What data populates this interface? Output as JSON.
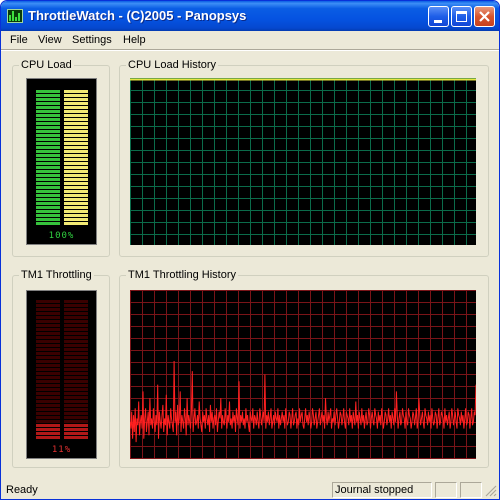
{
  "window": {
    "title": "ThrottleWatch - (C)2005 - Panopsys"
  },
  "menu": {
    "items": [
      "File",
      "View",
      "Settings",
      "Help"
    ]
  },
  "cpu_load": {
    "label": "CPU Load",
    "percent_text": "100%",
    "level": 1.0,
    "bar_colors": {
      "left": "#36c23c",
      "right": "#f2ea74"
    },
    "percent_color": "#30d040"
  },
  "cpu_history": {
    "label": "CPU Load History",
    "grid_color": "#0b6b4a",
    "line_color": "#e6e640"
  },
  "tm1_throttling": {
    "label": "TM1 Throttling",
    "percent_text": "11%",
    "level": 0.11,
    "bar_color": "#b01818",
    "dim_color": "#3a0000",
    "percent_color": "#e03030"
  },
  "tm1_history": {
    "label": "TM1 Throttling History",
    "grid_color": "#7a1418",
    "line_color": "#ff2020",
    "values": [
      22,
      18,
      28,
      12,
      26,
      16,
      30,
      10,
      24,
      20,
      34,
      14,
      22,
      26,
      18,
      40,
      12,
      24,
      30,
      16,
      22,
      28,
      14,
      36,
      20,
      24,
      18,
      30,
      22,
      16,
      26,
      20,
      44,
      12,
      28,
      22,
      18,
      26,
      32,
      16,
      24,
      20,
      38,
      14,
      26,
      22,
      18,
      30,
      24,
      20,
      16,
      58,
      22,
      28,
      14,
      32,
      20,
      24,
      40,
      16,
      26,
      22,
      18,
      30,
      24,
      14,
      36,
      20,
      26,
      22,
      18,
      28,
      52,
      16,
      24,
      30,
      20,
      22,
      26,
      18,
      34,
      24,
      20,
      16,
      28,
      22,
      26,
      18,
      30,
      24,
      20,
      26,
      16,
      32,
      22,
      28,
      18,
      24,
      26,
      20,
      30,
      16,
      22,
      28,
      24,
      36,
      18,
      26,
      22,
      20,
      30,
      24,
      18,
      26,
      22,
      34,
      20,
      24,
      18,
      28,
      22,
      26,
      16,
      30,
      24,
      20,
      46,
      18,
      26,
      22,
      28,
      20,
      24,
      18,
      30,
      22,
      26,
      20,
      16,
      28,
      24,
      22,
      30,
      18,
      26,
      24,
      20,
      28,
      22,
      18,
      30,
      26,
      20,
      24,
      28,
      22,
      50,
      18,
      26,
      22,
      28,
      20,
      24,
      30,
      18,
      22,
      26,
      20,
      28,
      24,
      22,
      30,
      18,
      26,
      20,
      24,
      28,
      22,
      26,
      18,
      30,
      24,
      20,
      22,
      28,
      26,
      18,
      24,
      30,
      20,
      22,
      26,
      28,
      18,
      24,
      20,
      30,
      22,
      26,
      28,
      20,
      18,
      24,
      30,
      22,
      26,
      20,
      28,
      24,
      18,
      22,
      30,
      26,
      20,
      24,
      28,
      18,
      22,
      26,
      30,
      20,
      24,
      28,
      22,
      26,
      18,
      36,
      24,
      20,
      28,
      22,
      26,
      30,
      18,
      24,
      22,
      28,
      20,
      26,
      30,
      24,
      18,
      22,
      28,
      26,
      20,
      24,
      30,
      22,
      18,
      28,
      26,
      24,
      20,
      30,
      22,
      26,
      18,
      28,
      24,
      20,
      34,
      22,
      26,
      18,
      28,
      24,
      20,
      30,
      22,
      26,
      18,
      24,
      28,
      20,
      22,
      30,
      26,
      18,
      24,
      28,
      22,
      20,
      30,
      26,
      24,
      18,
      28,
      22,
      26,
      20,
      30,
      24,
      18,
      22,
      28,
      26,
      20,
      24,
      30,
      22,
      26,
      18,
      28,
      24,
      20,
      30,
      22,
      40,
      26,
      18,
      24,
      28,
      20,
      22,
      30,
      26,
      24,
      18,
      28,
      22,
      20,
      30,
      26,
      24,
      18,
      22,
      28,
      26,
      20,
      24,
      30,
      18,
      22,
      36,
      26,
      20,
      24,
      28,
      22,
      18,
      30,
      26,
      24,
      20,
      28,
      22,
      26,
      18,
      30,
      24,
      20,
      22,
      28,
      26,
      18,
      24,
      30,
      20,
      22,
      28,
      26,
      24,
      18,
      30,
      22,
      26,
      20,
      24,
      28,
      18,
      22,
      30,
      26,
      20,
      24,
      28,
      22,
      18,
      30,
      26,
      24,
      20,
      28,
      22,
      26,
      18,
      24,
      30,
      20,
      22,
      28,
      26,
      18,
      24,
      30,
      20,
      22,
      28,
      26,
      44
    ]
  },
  "status": {
    "left": "Ready",
    "journal": "Journal stopped"
  }
}
